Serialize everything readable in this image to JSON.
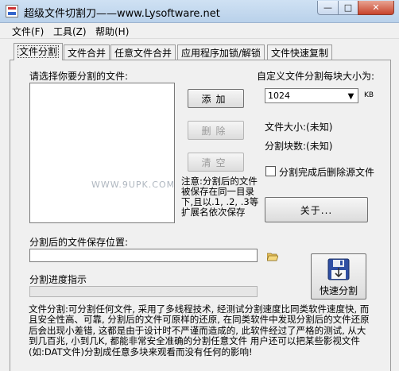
{
  "window": {
    "title": "超级文件切割刀——www.Lysoftware.net",
    "min_glyph": "—",
    "max_glyph": "□",
    "close_glyph": "✕"
  },
  "menu": [
    "文件(F)",
    "工具(Z)",
    "帮助(H)"
  ],
  "tabs": [
    "文件分割",
    "文件合并",
    "任意文件合并",
    "应用程序加锁/解锁",
    "文件快速复制"
  ],
  "split": {
    "select_files_label": "请选择你要分割的文件:",
    "add_button": "添加",
    "delete_button": "删除",
    "clear_button": "清空",
    "chunk_size_label": "自定义文件分割每块大小为:",
    "chunk_size_value": "1024",
    "chunk_unit": "KB",
    "file_size_label": "文件大小:(未知)",
    "chunk_count_label": "分割块数:(未知)",
    "delete_source_label": "分割完成后删除源文件",
    "note": "注意:分割后的文件被保存在同一目录下,且以.1, .2, .3等扩展名依次保存",
    "about_button": "关于...",
    "save_location_label": "分割后的文件保存位置:",
    "save_location_value": "",
    "progress_label": "分割进度指示",
    "progress": 0,
    "quick_split_button": "快速分割",
    "description": "文件分割:可分割任何文件, 采用了多线程技术, 经测试分割速度比同类软件速度快, 而且安全性高、可靠, 分割后的文件可原样的还原, 在同类软件中发现分割后的文件还原后会出现小差错, 这都是由于设计时不严谨而造成的, 此软件经过了严格的测试, 从大到几百兆, 小到几K, 都能非常安全准确的分割任意文件 用户还可以把某些影视文件(如:DAT文件)分割成任意多块来观看而没有任何的影响!"
  },
  "watermark": "WWW.9UPK.COM",
  "icons": {
    "folder": "folder-open-icon",
    "disk": "floppy-disk-icon",
    "app": "app-icon"
  },
  "colors": {
    "titlebar": "#b9d1ea",
    "close_button": "#c7432b",
    "window_bg": "#f0f0f0"
  }
}
